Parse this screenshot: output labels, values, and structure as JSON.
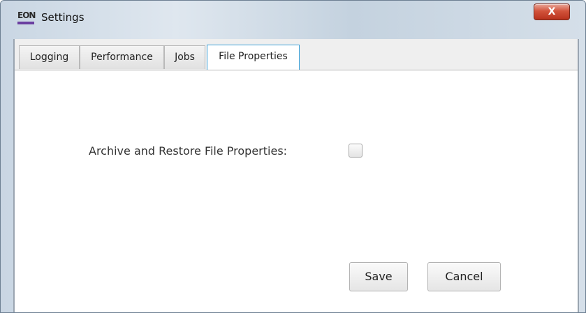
{
  "window": {
    "title": "Settings",
    "app_icon": "eon-logo-icon",
    "app_icon_text": "EON",
    "close_symbol": "X"
  },
  "tabs": [
    {
      "label": "Logging",
      "active": false
    },
    {
      "label": "Performance",
      "active": false
    },
    {
      "label": "Jobs",
      "active": false
    },
    {
      "label": "File Properties",
      "active": true
    }
  ],
  "file_properties": {
    "archive_restore_label": "Archive and Restore File Properties:",
    "archive_restore_checked": false
  },
  "buttons": {
    "save_label": "Save",
    "cancel_label": "Cancel"
  },
  "colors": {
    "active_tab_border": "#3aa0d8",
    "close_button": "#c9432c",
    "logo_accent": "#6b3fa0"
  }
}
